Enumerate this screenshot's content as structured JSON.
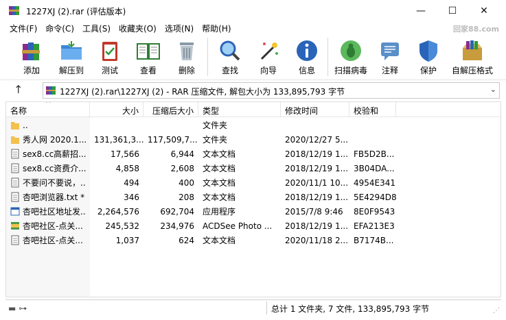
{
  "window": {
    "title": "1227XJ  (2).rar (评估版本)",
    "minimize": "—",
    "maximize": "☐",
    "close": "✕"
  },
  "menu": [
    "文件(F)",
    "命令(C)",
    "工具(S)",
    "收藏夹(O)",
    "选项(N)",
    "帮助(H)"
  ],
  "watermark": "回家88.com",
  "toolbar": [
    {
      "label": "添加",
      "icon": "books-add-icon"
    },
    {
      "label": "解压到",
      "icon": "folder-extract-icon"
    },
    {
      "label": "测试",
      "icon": "clipboard-test-icon"
    },
    {
      "label": "查看",
      "icon": "book-view-icon"
    },
    {
      "label": "删除",
      "icon": "trash-icon"
    },
    {
      "label": "查找",
      "icon": "magnifier-icon"
    },
    {
      "label": "向导",
      "icon": "wand-icon"
    },
    {
      "label": "信息",
      "icon": "info-icon"
    },
    {
      "label": "扫描病毒",
      "icon": "bug-scan-icon"
    },
    {
      "label": "注释",
      "icon": "comment-icon"
    },
    {
      "label": "保护",
      "icon": "shield-icon"
    },
    {
      "label": "自解压格式",
      "icon": "sfx-box-icon"
    }
  ],
  "address": {
    "up": "↑",
    "path": "1227XJ  (2).rar\\1227XJ  (2) - RAR 压缩文件, 解包大小为 133,895,793 字节",
    "dropdown": "⌄"
  },
  "columns": {
    "name": "名称",
    "size": "大小",
    "packed": "压缩后大小",
    "type": "类型",
    "mtime": "修改时间",
    "crc": "校验和",
    "sort": "^"
  },
  "files": [
    {
      "name": "..",
      "size": "",
      "packed": "",
      "type": "文件夹",
      "mtime": "",
      "crc": "",
      "icon": "folder-up-icon"
    },
    {
      "name": "秀人网  2020.1...",
      "size": "131,361,3...",
      "packed": "117,509,7...",
      "type": "文件夹",
      "mtime": "2020/12/27 5...",
      "crc": "",
      "icon": "folder-icon"
    },
    {
      "name": "sex8.cc高薪招...",
      "size": "17,566",
      "packed": "6,944",
      "type": "文本文档",
      "mtime": "2018/12/19 1...",
      "crc": "FB5D2B...",
      "icon": "text-file-icon"
    },
    {
      "name": "sex8.cc资费介...",
      "size": "4,858",
      "packed": "2,608",
      "type": "文本文档",
      "mtime": "2018/12/19 1...",
      "crc": "3B04DA...",
      "icon": "text-file-icon"
    },
    {
      "name": "不要问不要说，...",
      "size": "494",
      "packed": "400",
      "type": "文本文档",
      "mtime": "2020/11/1 10...",
      "crc": "4954E341",
      "icon": "text-file-icon"
    },
    {
      "name": "杏吧浏览器.txt *",
      "size": "346",
      "packed": "208",
      "type": "文本文档",
      "mtime": "2018/12/19 1...",
      "crc": "5E4294D8",
      "icon": "text-file-icon"
    },
    {
      "name": "杏吧社区地址发...",
      "size": "2,264,576",
      "packed": "692,704",
      "type": "应用程序",
      "mtime": "2015/7/8 9:46",
      "crc": "8E0F9543",
      "icon": "exe-file-icon"
    },
    {
      "name": "杏吧社区-点关...",
      "size": "245,532",
      "packed": "234,976",
      "type": "ACDSee Photo ...",
      "mtime": "2018/12/19 1...",
      "crc": "EFA213E3",
      "icon": "jpg-file-icon"
    },
    {
      "name": "杏吧社区-点关...",
      "size": "1,037",
      "packed": "624",
      "type": "文本文档",
      "mtime": "2020/11/18 2...",
      "crc": "B7174B...",
      "icon": "text-file-icon"
    }
  ],
  "status": {
    "left_icons": "▬ ⊶",
    "text": "总计 1 文件夹, 7 文件, 133,895,793 字节",
    "grip": "⋰"
  }
}
